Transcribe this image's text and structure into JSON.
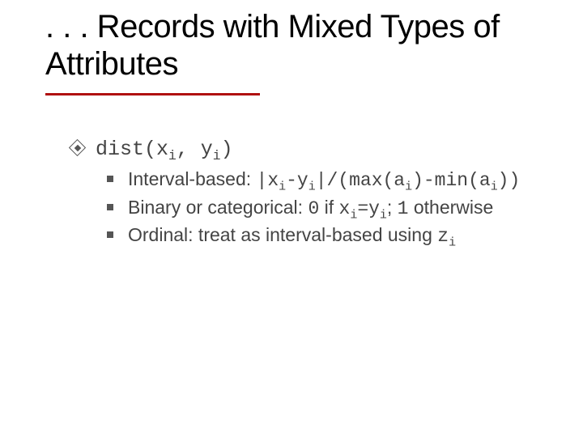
{
  "title": ". . . Records with Mixed Types of Attributes",
  "main": {
    "dist_prefix": "dist(x",
    "dist_mid": ", y",
    "dist_suffix": ")",
    "sub_i": "i"
  },
  "items": [
    {
      "label_prefix": "Interval-based: ",
      "f1": "|x",
      "f2": "-y",
      "f3": "|/(max(a",
      "f4": ")-min(a",
      "f5": "))"
    },
    {
      "label_prefix": "Binary or categorical: ",
      "c1": "0",
      "mid1": " if ",
      "c2": "x",
      "c3": "=y",
      "mid2": "; ",
      "c4": "1",
      "tail": " otherwise"
    },
    {
      "label_prefix": "Ordinal: treat as interval-based using ",
      "z": "z"
    }
  ],
  "chart_data": {
    "type": "table",
    "title": "Records with Mixed Types of Attributes — distance components",
    "categories": [
      "Interval-based",
      "Binary or categorical",
      "Ordinal"
    ],
    "values": [
      "|x_i - y_i| / (max(a_i) - min(a_i))",
      "0 if x_i = y_i; 1 otherwise",
      "treat as interval-based using z_i"
    ]
  }
}
